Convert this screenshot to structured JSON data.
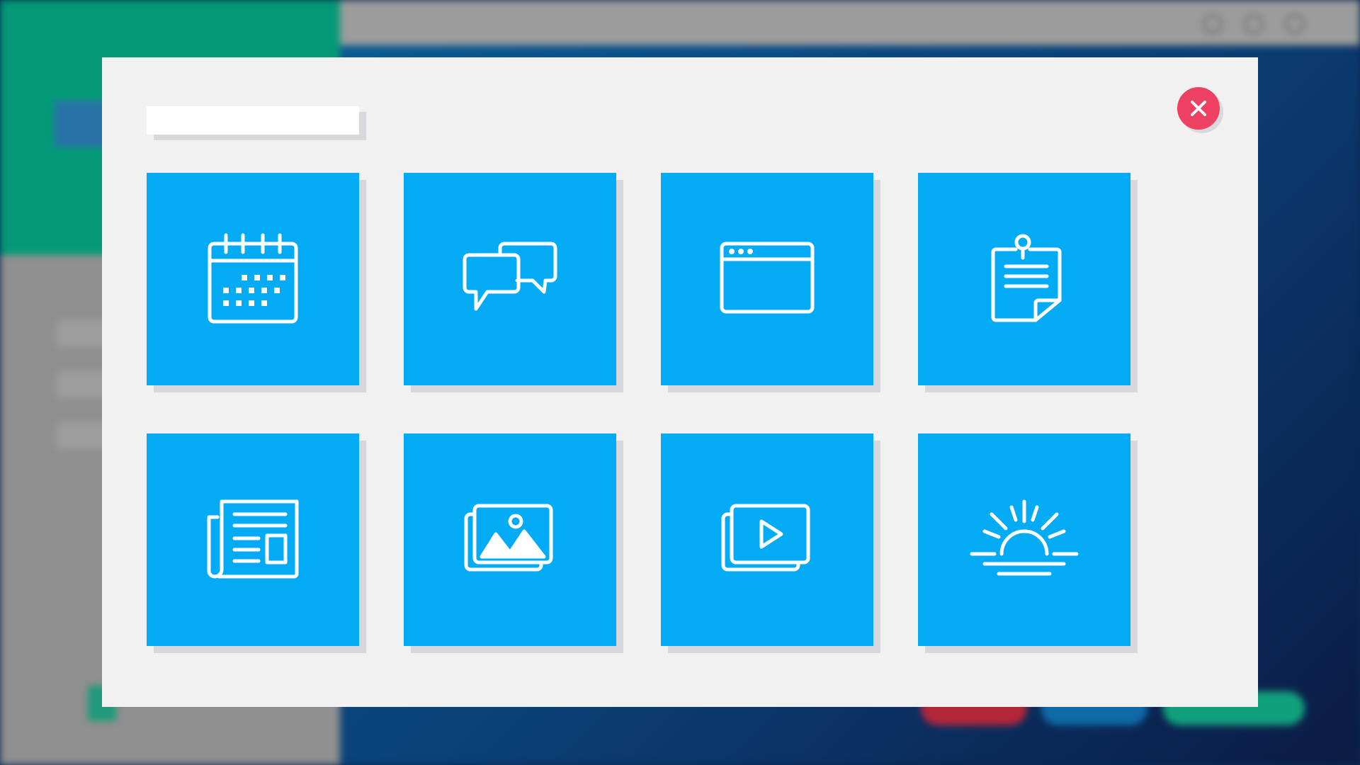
{
  "modal": {
    "title": "",
    "close_label": "close",
    "tiles": [
      {
        "icon": "calendar-icon"
      },
      {
        "icon": "chat-bubbles-icon"
      },
      {
        "icon": "browser-window-icon"
      },
      {
        "icon": "pinned-note-icon"
      },
      {
        "icon": "newspaper-icon"
      },
      {
        "icon": "image-gallery-icon"
      },
      {
        "icon": "video-gallery-icon"
      },
      {
        "icon": "sunrise-icon"
      }
    ]
  },
  "colors": {
    "tile": "#03aaf4",
    "close": "#ee4060",
    "modal_bg": "#f1f1f1",
    "background_sidebar": "#049a77"
  }
}
